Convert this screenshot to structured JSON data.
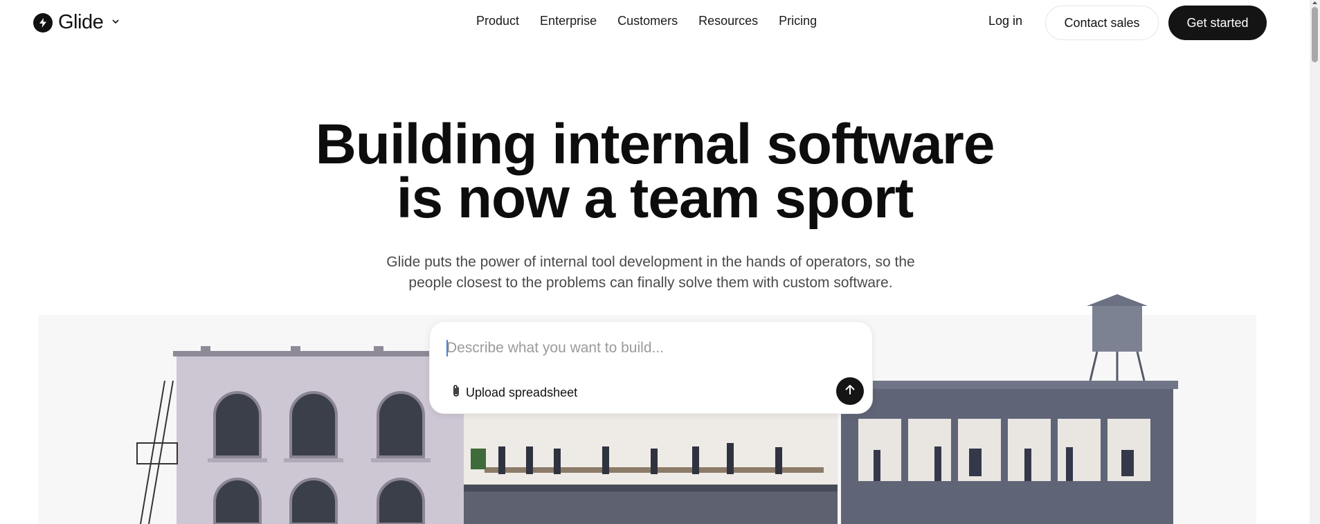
{
  "brand": {
    "name": "Glide"
  },
  "nav": {
    "links": [
      "Product",
      "Enterprise",
      "Customers",
      "Resources",
      "Pricing"
    ],
    "login": "Log in",
    "contact": "Contact sales",
    "get_started": "Get started"
  },
  "hero": {
    "title_line1": "Building internal software",
    "title_line2": "is now a team sport",
    "subtitle_line1": "Glide puts the power of internal tool development in the hands of operators, so the",
    "subtitle_line2": "people closest to the problems can finally solve them with custom software."
  },
  "prompt": {
    "placeholder": "Describe what you want to build...",
    "upload_label": "Upload spreadsheet"
  },
  "colors": {
    "dark": "#141414",
    "text": "#0d0d0d",
    "muted": "#4a4a4a",
    "building_left": "#c9c4d2",
    "building_right": "#5f6477"
  },
  "icons": [
    "glide-logo-icon",
    "chevron-down-icon",
    "paperclip-icon",
    "arrow-up-icon"
  ]
}
